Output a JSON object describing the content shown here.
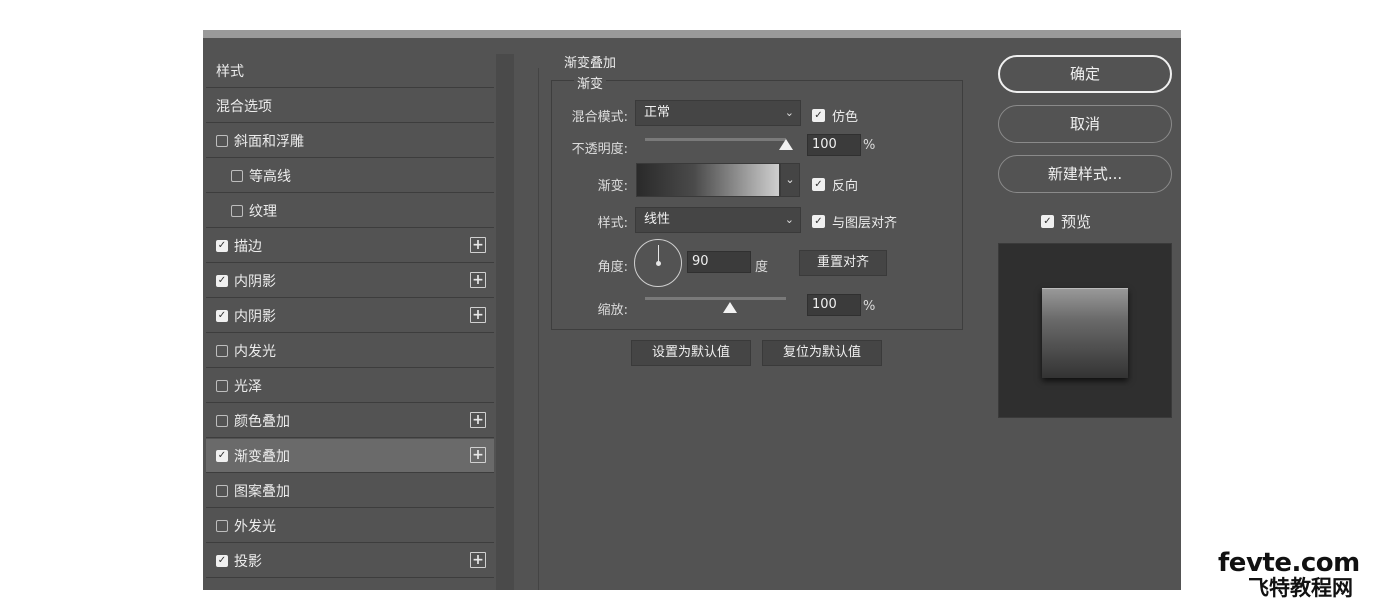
{
  "left_list": {
    "header": "样式",
    "items": [
      {
        "label": "混合选项",
        "checkbox": null,
        "plus": false
      },
      {
        "label": "斜面和浮雕",
        "checkbox": false,
        "plus": false
      },
      {
        "label": "等高线",
        "checkbox": false,
        "plus": false,
        "indent": true
      },
      {
        "label": "纹理",
        "checkbox": false,
        "plus": false,
        "indent": true
      },
      {
        "label": "描边",
        "checkbox": true,
        "plus": true
      },
      {
        "label": "内阴影",
        "checkbox": true,
        "plus": true
      },
      {
        "label": "内阴影",
        "checkbox": true,
        "plus": true
      },
      {
        "label": "内发光",
        "checkbox": false,
        "plus": false
      },
      {
        "label": "光泽",
        "checkbox": false,
        "plus": false
      },
      {
        "label": "颜色叠加",
        "checkbox": false,
        "plus": true
      },
      {
        "label": "渐变叠加",
        "checkbox": true,
        "plus": true,
        "selected": true
      },
      {
        "label": "图案叠加",
        "checkbox": false,
        "plus": false
      },
      {
        "label": "外发光",
        "checkbox": false,
        "plus": false
      },
      {
        "label": "投影",
        "checkbox": true,
        "plus": true
      }
    ]
  },
  "panel": {
    "group_title": "渐变叠加",
    "sub_title": "渐变",
    "blend_mode_label": "混合模式:",
    "blend_mode_value": "正常",
    "dither_label": "仿色",
    "opacity_label": "不透明度:",
    "opacity_value": "100",
    "opacity_unit": "%",
    "opacity_slider": 1.0,
    "gradient_label": "渐变:",
    "reverse_label": "反向",
    "style_label": "样式:",
    "style_value": "线性",
    "align_label": "与图层对齐",
    "angle_label": "角度:",
    "angle_value": "90",
    "angle_unit": "度",
    "reset_align_button": "重置对齐",
    "scale_label": "缩放:",
    "scale_value": "100",
    "scale_unit": "%",
    "scale_slider": 0.6,
    "set_default_button": "设置为默认值",
    "reset_default_button": "复位为默认值"
  },
  "right": {
    "ok_button": "确定",
    "cancel_button": "取消",
    "new_style_button": "新建样式...",
    "preview_label": "预览"
  },
  "watermark": {
    "line1_a": "fe",
    "line1_b": "v",
    "line1_c": "te.com",
    "line2": "飞特教程网"
  },
  "colors": {
    "dialog_bg": "#535353",
    "selected_row": "#6a6a6a"
  }
}
